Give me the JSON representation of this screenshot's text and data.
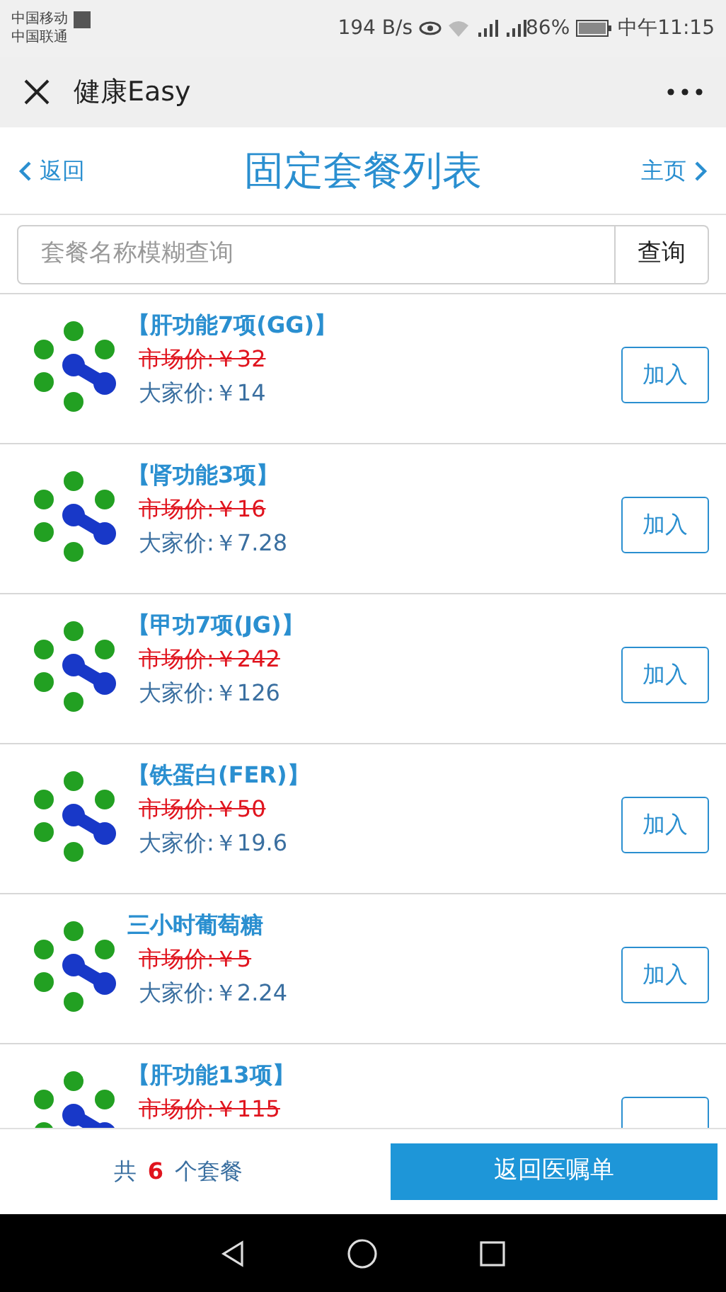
{
  "status_bar": {
    "carrier_1": "中国移动",
    "carrier_2": "中国联通",
    "speed": "194 B/s",
    "battery": "86%",
    "time": "中午11:15"
  },
  "title_bar": {
    "title": "健康Easy"
  },
  "header": {
    "back": "返回",
    "title": "固定套餐列表",
    "home": "主页"
  },
  "search": {
    "placeholder": "套餐名称模糊查询",
    "button": "查询"
  },
  "packages": [
    {
      "name": "【肝功能7项(GG)】",
      "market_price": "市场价:￥32",
      "our_price": "大家价:￥14",
      "button": "加入"
    },
    {
      "name": "【肾功能3项】",
      "market_price": "市场价:￥16",
      "our_price": "大家价:￥7.28",
      "button": "加入"
    },
    {
      "name": "【甲功7项(JG)】",
      "market_price": "市场价:￥242",
      "our_price": "大家价:￥126",
      "button": "加入"
    },
    {
      "name": "【铁蛋白(FER)】",
      "market_price": "市场价:￥50",
      "our_price": "大家价:￥19.6",
      "button": "加入"
    },
    {
      "name": "三小时葡萄糖",
      "market_price": "市场价:￥5",
      "our_price": "大家价:￥2.24",
      "button": "加入"
    },
    {
      "name": "【肝功能13项】",
      "market_price": "市场价:￥115"
    }
  ],
  "footer": {
    "count_prefix": "共",
    "count": "6",
    "count_suffix": "个套餐",
    "button": "返回医嘱单"
  }
}
